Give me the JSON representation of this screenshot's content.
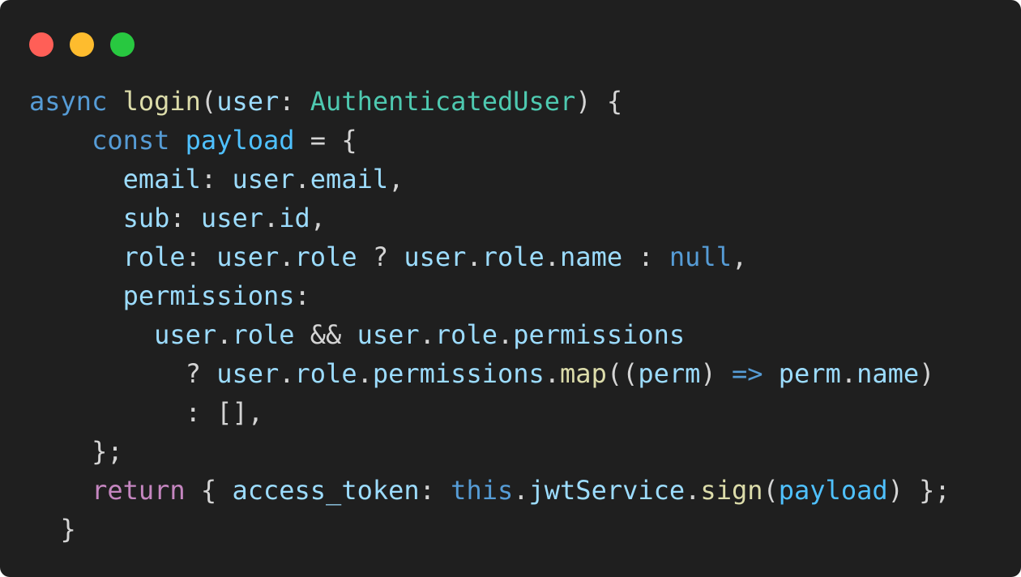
{
  "window": {
    "buttons": [
      {
        "name": "close",
        "color": "#ff5f57"
      },
      {
        "name": "minimize",
        "color": "#febc2e"
      },
      {
        "name": "zoom",
        "color": "#28c840"
      }
    ]
  },
  "colors": {
    "background": "#1f1f1f",
    "keyword": "#569cd6",
    "control": "#c586c0",
    "function": "#dcdcaa",
    "variable": "#9cdcfe",
    "constant": "#4fc1ff",
    "type": "#4ec9b0",
    "punctuation": "#d4d4d4"
  },
  "code": {
    "lines": [
      [
        {
          "t": "kw",
          "v": "async"
        },
        {
          "t": "punct",
          "v": " "
        },
        {
          "t": "fn",
          "v": "login"
        },
        {
          "t": "punct",
          "v": "("
        },
        {
          "t": "var",
          "v": "user"
        },
        {
          "t": "punct",
          "v": ": "
        },
        {
          "t": "type",
          "v": "AuthenticatedUser"
        },
        {
          "t": "punct",
          "v": ") {"
        }
      ],
      [
        {
          "t": "punct",
          "v": "    "
        },
        {
          "t": "kw",
          "v": "const"
        },
        {
          "t": "punct",
          "v": " "
        },
        {
          "t": "const",
          "v": "payload"
        },
        {
          "t": "punct",
          "v": " = {"
        }
      ],
      [
        {
          "t": "punct",
          "v": "      "
        },
        {
          "t": "var",
          "v": "email"
        },
        {
          "t": "punct",
          "v": ": "
        },
        {
          "t": "var",
          "v": "user"
        },
        {
          "t": "punct",
          "v": "."
        },
        {
          "t": "var",
          "v": "email"
        },
        {
          "t": "punct",
          "v": ","
        }
      ],
      [
        {
          "t": "punct",
          "v": "      "
        },
        {
          "t": "var",
          "v": "sub"
        },
        {
          "t": "punct",
          "v": ": "
        },
        {
          "t": "var",
          "v": "user"
        },
        {
          "t": "punct",
          "v": "."
        },
        {
          "t": "var",
          "v": "id"
        },
        {
          "t": "punct",
          "v": ","
        }
      ],
      [
        {
          "t": "punct",
          "v": "      "
        },
        {
          "t": "var",
          "v": "role"
        },
        {
          "t": "punct",
          "v": ": "
        },
        {
          "t": "var",
          "v": "user"
        },
        {
          "t": "punct",
          "v": "."
        },
        {
          "t": "var",
          "v": "role"
        },
        {
          "t": "punct",
          "v": " ? "
        },
        {
          "t": "var",
          "v": "user"
        },
        {
          "t": "punct",
          "v": "."
        },
        {
          "t": "var",
          "v": "role"
        },
        {
          "t": "punct",
          "v": "."
        },
        {
          "t": "var",
          "v": "name"
        },
        {
          "t": "punct",
          "v": " : "
        },
        {
          "t": "kw",
          "v": "null"
        },
        {
          "t": "punct",
          "v": ","
        }
      ],
      [
        {
          "t": "punct",
          "v": "      "
        },
        {
          "t": "var",
          "v": "permissions"
        },
        {
          "t": "punct",
          "v": ":"
        }
      ],
      [
        {
          "t": "punct",
          "v": "        "
        },
        {
          "t": "var",
          "v": "user"
        },
        {
          "t": "punct",
          "v": "."
        },
        {
          "t": "var",
          "v": "role"
        },
        {
          "t": "punct",
          "v": " && "
        },
        {
          "t": "var",
          "v": "user"
        },
        {
          "t": "punct",
          "v": "."
        },
        {
          "t": "var",
          "v": "role"
        },
        {
          "t": "punct",
          "v": "."
        },
        {
          "t": "var",
          "v": "permissions"
        }
      ],
      [
        {
          "t": "punct",
          "v": "          ? "
        },
        {
          "t": "var",
          "v": "user"
        },
        {
          "t": "punct",
          "v": "."
        },
        {
          "t": "var",
          "v": "role"
        },
        {
          "t": "punct",
          "v": "."
        },
        {
          "t": "var",
          "v": "permissions"
        },
        {
          "t": "punct",
          "v": "."
        },
        {
          "t": "fn",
          "v": "map"
        },
        {
          "t": "punct",
          "v": "(("
        },
        {
          "t": "var",
          "v": "perm"
        },
        {
          "t": "punct",
          "v": ") "
        },
        {
          "t": "kw",
          "v": "=>"
        },
        {
          "t": "punct",
          "v": " "
        },
        {
          "t": "var",
          "v": "perm"
        },
        {
          "t": "punct",
          "v": "."
        },
        {
          "t": "var",
          "v": "name"
        },
        {
          "t": "punct",
          "v": ")"
        }
      ],
      [
        {
          "t": "punct",
          "v": "          : [],"
        }
      ],
      [
        {
          "t": "punct",
          "v": "    };"
        }
      ],
      [
        {
          "t": "punct",
          "v": "    "
        },
        {
          "t": "ctrl",
          "v": "return"
        },
        {
          "t": "punct",
          "v": " { "
        },
        {
          "t": "var",
          "v": "access_token"
        },
        {
          "t": "punct",
          "v": ": "
        },
        {
          "t": "kw",
          "v": "this"
        },
        {
          "t": "punct",
          "v": "."
        },
        {
          "t": "var",
          "v": "jwtService"
        },
        {
          "t": "punct",
          "v": "."
        },
        {
          "t": "fn",
          "v": "sign"
        },
        {
          "t": "punct",
          "v": "("
        },
        {
          "t": "const",
          "v": "payload"
        },
        {
          "t": "punct",
          "v": ") };"
        }
      ],
      [
        {
          "t": "punct",
          "v": "  }"
        }
      ]
    ]
  }
}
